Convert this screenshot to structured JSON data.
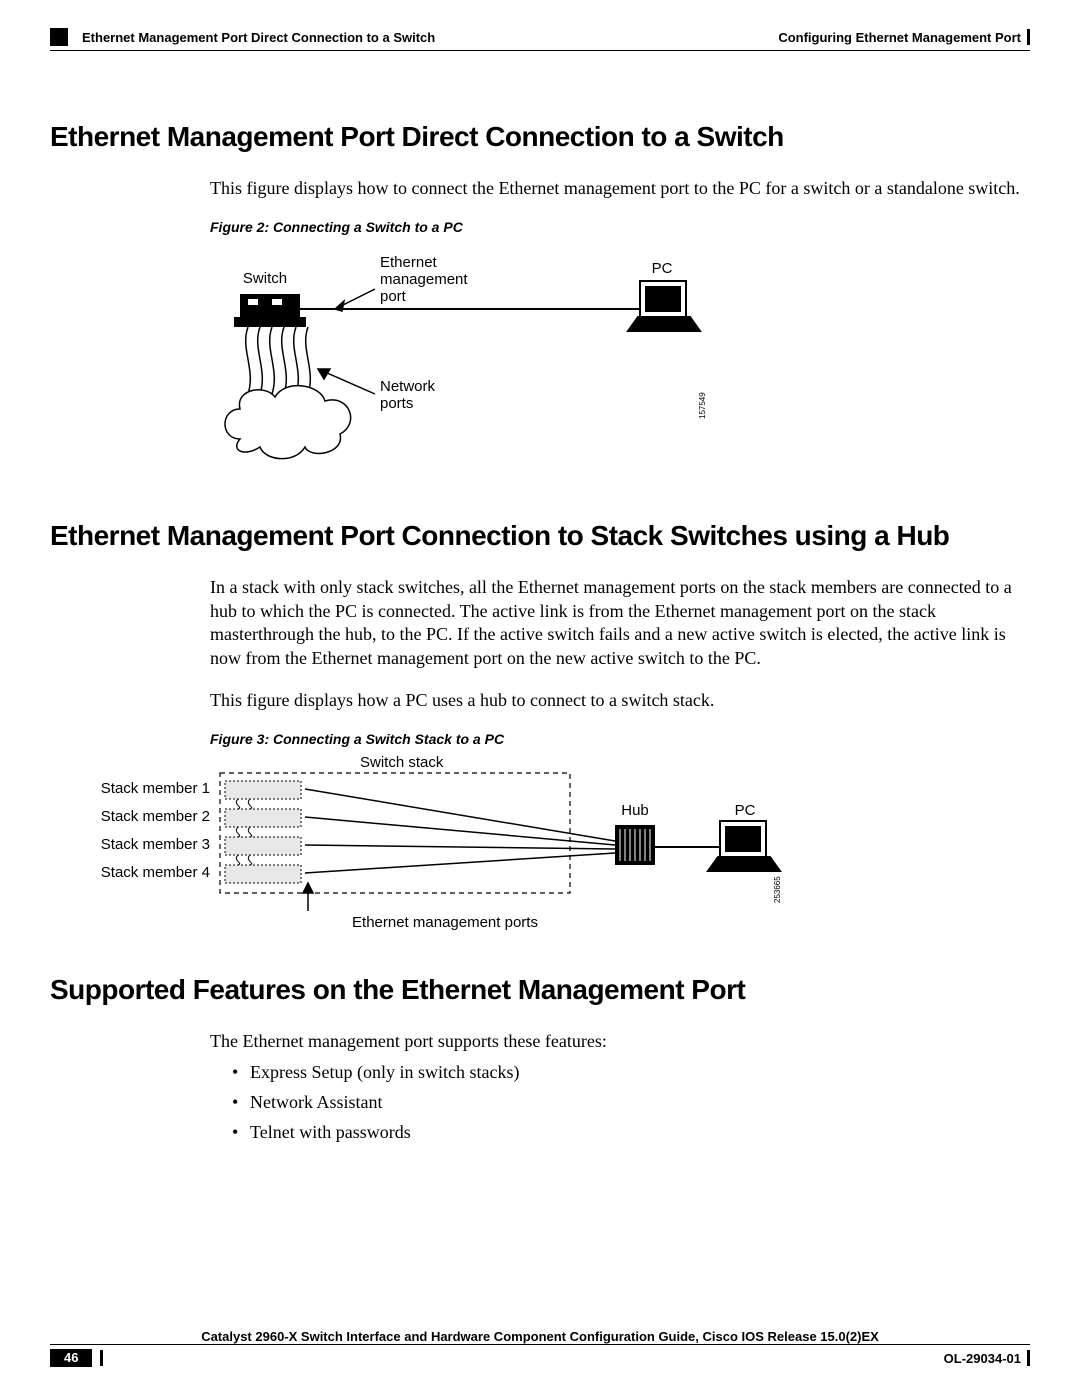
{
  "header": {
    "left": "Ethernet Management Port Direct Connection to a Switch",
    "right": "Configuring Ethernet Management Port"
  },
  "section1": {
    "heading": "Ethernet Management Port Direct Connection to a Switch",
    "para": "This figure displays how to connect the Ethernet management port to the PC for a switch or a standalone switch.",
    "fig_caption": "Figure 2: Connecting a Switch to a PC",
    "fig_labels": {
      "switch": "Switch",
      "mgmt1": "Ethernet",
      "mgmt2": "management",
      "mgmt3": "port",
      "pc": "PC",
      "np1": "Network",
      "np2": "ports",
      "nc1": "Network",
      "nc2": "cloud",
      "id": "157549"
    }
  },
  "section2": {
    "heading": "Ethernet Management Port Connection to Stack Switches using a Hub",
    "para1": "In a stack with only stack switches, all the Ethernet management ports on the stack members are connected to a hub to which the PC is connected. The active link is from the Ethernet management port on the stack masterthrough the hub, to the PC. If the active switch fails and a new active switch is elected, the active link is now from the Ethernet management port on the new active switch to the PC.",
    "para2": "This figure displays how a PC uses a hub to connect to a switch stack.",
    "fig_caption": "Figure 3: Connecting a Switch Stack to a PC",
    "fig_labels": {
      "stack": "Switch stack",
      "m1": "Stack member 1",
      "m2": "Stack member 2",
      "m3": "Stack member 3",
      "m4": "Stack member 4",
      "hub": "Hub",
      "pc": "PC",
      "ports": "Ethernet management ports",
      "id": "253665"
    }
  },
  "section3": {
    "heading": "Supported Features on the Ethernet Management Port",
    "para": "The Ethernet management port supports these features:",
    "items": [
      "Express Setup (only in switch stacks)",
      "Network Assistant",
      "Telnet with passwords"
    ]
  },
  "footer": {
    "guide": "Catalyst 2960-X Switch Interface and Hardware Component Configuration Guide, Cisco IOS Release 15.0(2)EX",
    "page": "46",
    "docid": "OL-29034-01"
  }
}
